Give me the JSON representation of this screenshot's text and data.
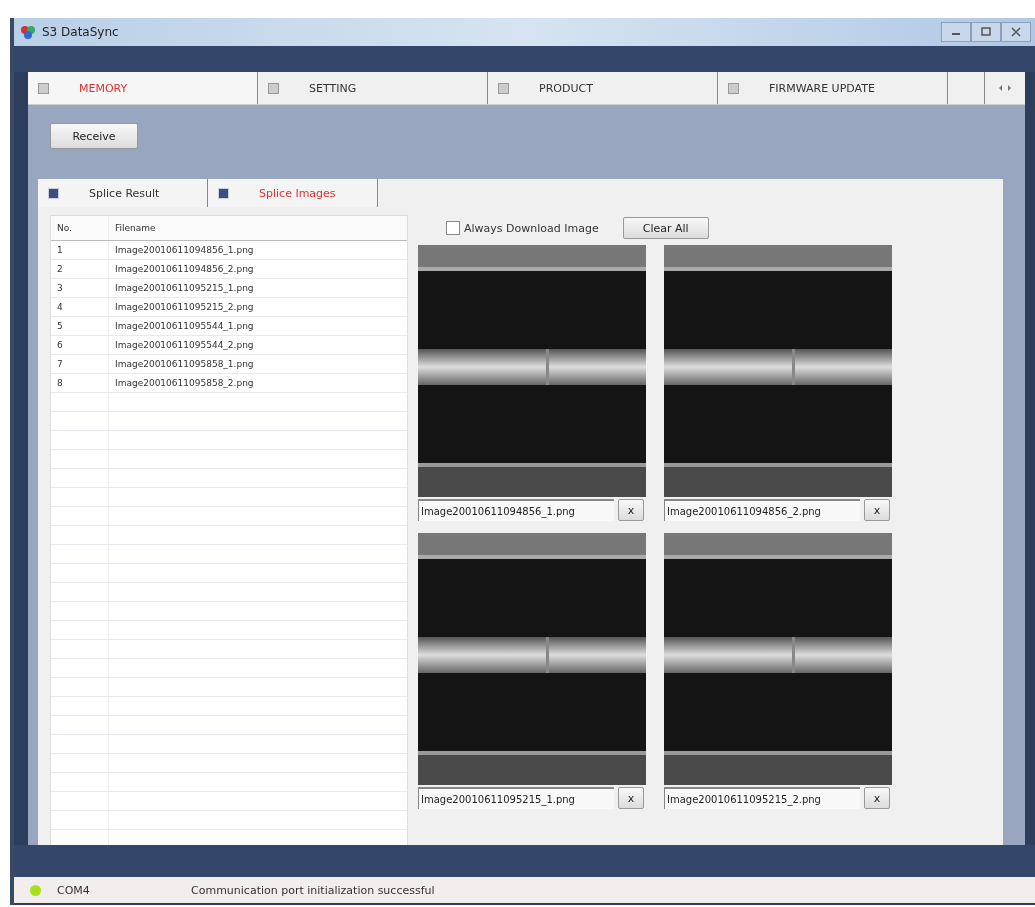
{
  "window": {
    "title": "S3 DataSync"
  },
  "tabs": [
    {
      "label": "MEMORY",
      "selected": true
    },
    {
      "label": "SETTING",
      "selected": false
    },
    {
      "label": "PRODUCT",
      "selected": false
    },
    {
      "label": "FIRMWARE UPDATE",
      "selected": false
    }
  ],
  "receive_button": "Receive",
  "sub_tabs": [
    {
      "label": "Splice Result",
      "selected": false
    },
    {
      "label": "Splice Images",
      "selected": true
    }
  ],
  "table": {
    "columns": [
      "No.",
      "Filename"
    ],
    "rows": [
      [
        "1",
        "Image20010611094856_1.png"
      ],
      [
        "2",
        "Image20010611094856_2.png"
      ],
      [
        "3",
        "Image20010611095215_1.png"
      ],
      [
        "4",
        "Image20010611095215_2.png"
      ],
      [
        "5",
        "Image20010611095544_1.png"
      ],
      [
        "6",
        "Image20010611095544_2.png"
      ],
      [
        "7",
        "Image20010611095858_1.png"
      ],
      [
        "8",
        "Image20010611095858_2.png"
      ]
    ]
  },
  "always_download": {
    "label": "Always Download Image",
    "checked": false
  },
  "clear_button": "Clear All",
  "images": [
    {
      "caption": "Image20010611094856_1.png",
      "remove": "x"
    },
    {
      "caption": "Image20010611094856_2.png",
      "remove": "x"
    },
    {
      "caption": "Image20010611095215_1.png",
      "remove": "x"
    },
    {
      "caption": "Image20010611095215_2.png",
      "remove": "x"
    }
  ],
  "status_bar": {
    "port": "COM4",
    "connected": true,
    "message": "Communication port initialization successful"
  }
}
